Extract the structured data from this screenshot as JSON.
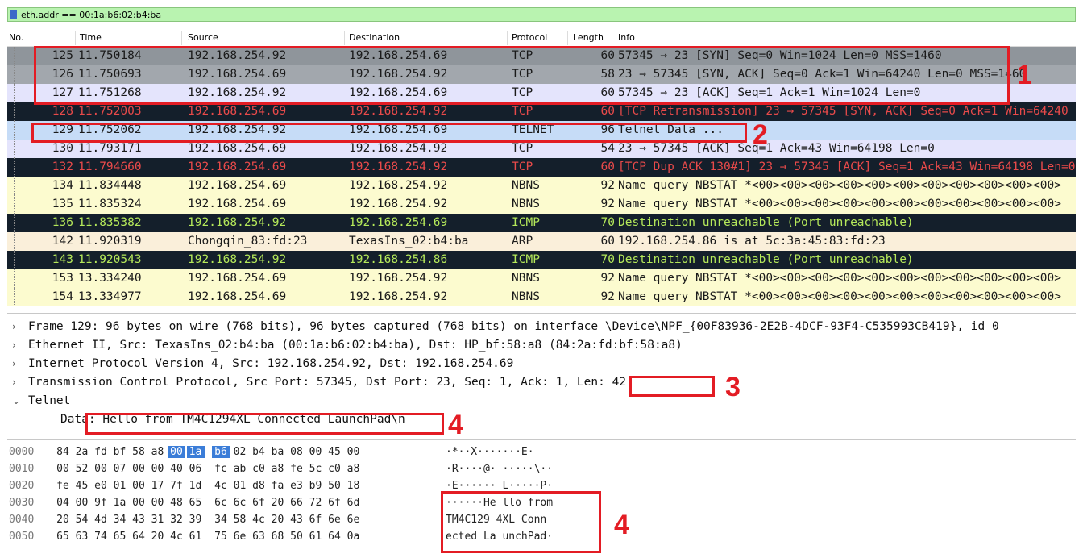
{
  "filter": {
    "value": "eth.addr == 00:1a:b6:02:b4:ba"
  },
  "columns": [
    "No.",
    "Time",
    "Source",
    "Destination",
    "Protocol",
    "Length",
    "Info"
  ],
  "packets": [
    {
      "no": "125",
      "time": "11.750184",
      "src": "192.168.254.92",
      "dst": "192.168.254.69",
      "proto": "TCP",
      "len": "60",
      "info": "57345 → 23 [SYN] Seq=0 Win=1024 Len=0 MSS=1460",
      "bg": "#8f959b",
      "fg": "#1a1a1a"
    },
    {
      "no": "126",
      "time": "11.750693",
      "src": "192.168.254.69",
      "dst": "192.168.254.92",
      "proto": "TCP",
      "len": "58",
      "info": "23 → 57345 [SYN, ACK] Seq=0 Ack=1 Win=64240 Len=0 MSS=1460",
      "bg": "#a2a7ad",
      "fg": "#1a1a1a"
    },
    {
      "no": "127",
      "time": "11.751268",
      "src": "192.168.254.92",
      "dst": "192.168.254.69",
      "proto": "TCP",
      "len": "60",
      "info": "57345 → 23 [ACK] Seq=1 Ack=1 Win=1024 Len=0",
      "bg": "#e4e4fc",
      "fg": "#1a1a1a"
    },
    {
      "no": "128",
      "time": "11.752003",
      "src": "192.168.254.69",
      "dst": "192.168.254.92",
      "proto": "TCP",
      "len": "60",
      "info": "[TCP Retransmission] 23 → 57345 [SYN, ACK] Seq=0 Ack=1 Win=64240",
      "bg": "#141f2b",
      "fg": "#e84a4a"
    },
    {
      "no": "129",
      "time": "11.752062",
      "src": "192.168.254.92",
      "dst": "192.168.254.69",
      "proto": "TELNET",
      "len": "96",
      "info": "Telnet Data ...",
      "bg": "#c6dcf7",
      "fg": "#1a1a1a"
    },
    {
      "no": "130",
      "time": "11.793171",
      "src": "192.168.254.69",
      "dst": "192.168.254.92",
      "proto": "TCP",
      "len": "54",
      "info": "23 → 57345 [ACK] Seq=1 Ack=43 Win=64198 Len=0",
      "bg": "#e4e4fc",
      "fg": "#1a1a1a"
    },
    {
      "no": "132",
      "time": "11.794660",
      "src": "192.168.254.69",
      "dst": "192.168.254.92",
      "proto": "TCP",
      "len": "60",
      "info": "[TCP Dup ACK 130#1] 23 → 57345 [ACK] Seq=1 Ack=43 Win=64198 Len=0",
      "bg": "#141f2b",
      "fg": "#e84a4a"
    },
    {
      "no": "134",
      "time": "11.834448",
      "src": "192.168.254.69",
      "dst": "192.168.254.92",
      "proto": "NBNS",
      "len": "92",
      "info": "Name query NBSTAT *<00><00><00><00><00><00><00><00><00><00><00>",
      "bg": "#fcfbcf",
      "fg": "#1a1a1a"
    },
    {
      "no": "135",
      "time": "11.835324",
      "src": "192.168.254.69",
      "dst": "192.168.254.92",
      "proto": "NBNS",
      "len": "92",
      "info": "Name query NBSTAT *<00><00><00><00><00><00><00><00><00><00><00>",
      "bg": "#fcfbcf",
      "fg": "#1a1a1a"
    },
    {
      "no": "136",
      "time": "11.835382",
      "src": "192.168.254.92",
      "dst": "192.168.254.69",
      "proto": "ICMP",
      "len": "70",
      "info": "Destination unreachable (Port unreachable)",
      "bg": "#141f2b",
      "fg": "#b5e85a"
    },
    {
      "no": "142",
      "time": "11.920319",
      "src": "Chongqin_83:fd:23",
      "dst": "TexasIns_02:b4:ba",
      "proto": "ARP",
      "len": "60",
      "info": "192.168.254.86 is at 5c:3a:45:83:fd:23",
      "bg": "#faefda",
      "fg": "#1a1a1a"
    },
    {
      "no": "143",
      "time": "11.920543",
      "src": "192.168.254.92",
      "dst": "192.168.254.86",
      "proto": "ICMP",
      "len": "70",
      "info": "Destination unreachable (Port unreachable)",
      "bg": "#141f2b",
      "fg": "#b5e85a"
    },
    {
      "no": "153",
      "time": "13.334240",
      "src": "192.168.254.69",
      "dst": "192.168.254.92",
      "proto": "NBNS",
      "len": "92",
      "info": "Name query NBSTAT *<00><00><00><00><00><00><00><00><00><00><00>",
      "bg": "#fcfbcf",
      "fg": "#1a1a1a"
    },
    {
      "no": "154",
      "time": "13.334977",
      "src": "192.168.254.69",
      "dst": "192.168.254.92",
      "proto": "NBNS",
      "len": "92",
      "info": "Name query NBSTAT *<00><00><00><00><00><00><00><00><00><00><00>",
      "bg": "#fcfbcf",
      "fg": "#1a1a1a"
    }
  ],
  "details": [
    {
      "arrow": "›",
      "text": "Frame 129: 96 bytes on wire (768 bits), 96 bytes captured (768 bits) on interface \\Device\\NPF_{00F83936-2E2B-4DCF-93F4-C535993CB419}, id 0"
    },
    {
      "arrow": "›",
      "text": "Ethernet II, Src: TexasIns_02:b4:ba (00:1a:b6:02:b4:ba), Dst: HP_bf:58:a8 (84:2a:fd:bf:58:a8)"
    },
    {
      "arrow": "›",
      "text": "Internet Protocol Version 4, Src: 192.168.254.92, Dst: 192.168.254.69"
    },
    {
      "arrow": "›",
      "text": "Transmission Control Protocol, Src Port: 57345, Dst Port: 23, Seq: 1, Ack: 1, Len: 42"
    },
    {
      "arrow": "⌄",
      "text": "Telnet"
    },
    {
      "arrow": "",
      "text": "Data: Hello from TM4C1294XL Connected LaunchPad\\n"
    }
  ],
  "hex": [
    {
      "offset": "0000",
      "bytes": [
        "84",
        "2a",
        "fd",
        "bf",
        "58",
        "a8",
        "00",
        "1a",
        "b6",
        "02",
        "b4",
        "ba",
        "08",
        "00",
        "45",
        "00"
      ],
      "ascii": "·*··X·······E·"
    },
    {
      "offset": "0010",
      "bytes": [
        "00",
        "52",
        "00",
        "07",
        "00",
        "00",
        "40",
        "06",
        "fc",
        "ab",
        "c0",
        "a8",
        "fe",
        "5c",
        "c0",
        "a8"
      ],
      "ascii": "·R····@· ·····\\··"
    },
    {
      "offset": "0020",
      "bytes": [
        "fe",
        "45",
        "e0",
        "01",
        "00",
        "17",
        "7f",
        "1d",
        "4c",
        "01",
        "d8",
        "fa",
        "e3",
        "b9",
        "50",
        "18"
      ],
      "ascii": "·E······ L·····P·"
    },
    {
      "offset": "0030",
      "bytes": [
        "04",
        "00",
        "9f",
        "1a",
        "00",
        "00",
        "48",
        "65",
        "6c",
        "6c",
        "6f",
        "20",
        "66",
        "72",
        "6f",
        "6d"
      ],
      "ascii": "······He llo from"
    },
    {
      "offset": "0040",
      "bytes": [
        "20",
        "54",
        "4d",
        "34",
        "43",
        "31",
        "32",
        "39",
        "34",
        "58",
        "4c",
        "20",
        "43",
        "6f",
        "6e",
        "6e"
      ],
      "ascii": " TM4C129 4XL Conn"
    },
    {
      "offset": "0050",
      "bytes": [
        "65",
        "63",
        "74",
        "65",
        "64",
        "20",
        "4c",
        "61",
        "75",
        "6e",
        "63",
        "68",
        "50",
        "61",
        "64",
        "0a"
      ],
      "ascii": "ected La unchPad·"
    }
  ],
  "annotations": [
    "1",
    "2",
    "3",
    "4",
    "4"
  ],
  "colors": {
    "highlight": "#e31c24",
    "filter_bg": "#b9f3b0",
    "selection": "#3b7dd8"
  }
}
